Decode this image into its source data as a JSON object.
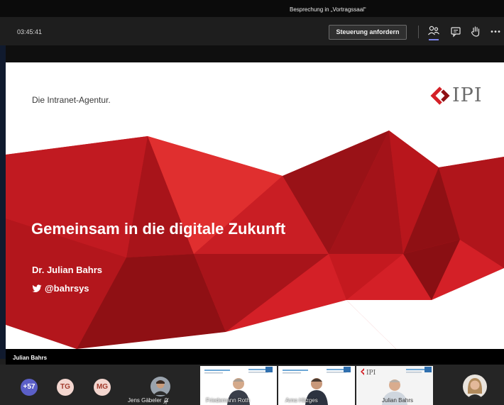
{
  "window": {
    "title": "Besprechung in „Vortragssaal“"
  },
  "meeting_bar": {
    "timer": "03:45:41",
    "request_control_label": "Steuerung anfordern"
  },
  "slide": {
    "tagline": "Die Intranet-Agentur.",
    "logo_text": "IPI",
    "title": "Gemeinsam in die digitale Zukunft",
    "presenter": "Dr. Julian Bahrs",
    "twitter_handle": "@bahrsys"
  },
  "speaker": {
    "name": "Julian Bahrs"
  },
  "participants": {
    "overflow_count": "+57",
    "avatars": [
      {
        "initials": "TG",
        "bg": "#f3d6cf",
        "fg": "#a23b2c"
      },
      {
        "initials": "MG",
        "bg": "#f3d6cf",
        "fg": "#a23b2c"
      }
    ],
    "tiles": [
      {
        "name": "Jens Gäbeler"
      },
      {
        "name": "Friedemann Roth"
      },
      {
        "name": "Arno Hitzges"
      },
      {
        "name": "Julian Bahrs"
      }
    ]
  },
  "colors": {
    "accent": "#7b83eb",
    "slide_red": "#d42027",
    "slide_dark_red": "#8f1014",
    "overflow_badge": "#5b5fc7"
  }
}
